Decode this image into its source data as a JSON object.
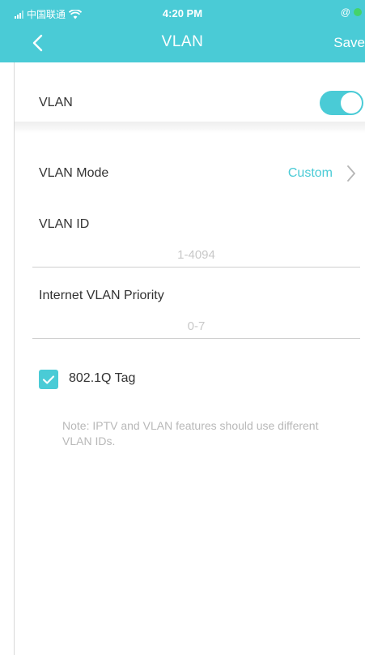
{
  "status_bar": {
    "carrier": "中国联通",
    "time": "4:20 PM",
    "right_symbol": "@"
  },
  "nav": {
    "title": "VLAN",
    "save_label": "Save",
    "back_icon": "chevron-left-icon"
  },
  "vlan_toggle": {
    "label": "VLAN",
    "enabled": true,
    "accent_color": "#4acbd6"
  },
  "vlan_mode": {
    "label": "VLAN Mode",
    "value": "Custom"
  },
  "vlan_id": {
    "label": "VLAN ID",
    "value": "",
    "placeholder": "1-4094"
  },
  "priority": {
    "label": "Internet VLAN Priority",
    "value": "",
    "placeholder": "0-7"
  },
  "tag": {
    "label": "802.1Q Tag",
    "checked": true
  },
  "note": "Note: IPTV and VLAN features should use different VLAN IDs."
}
